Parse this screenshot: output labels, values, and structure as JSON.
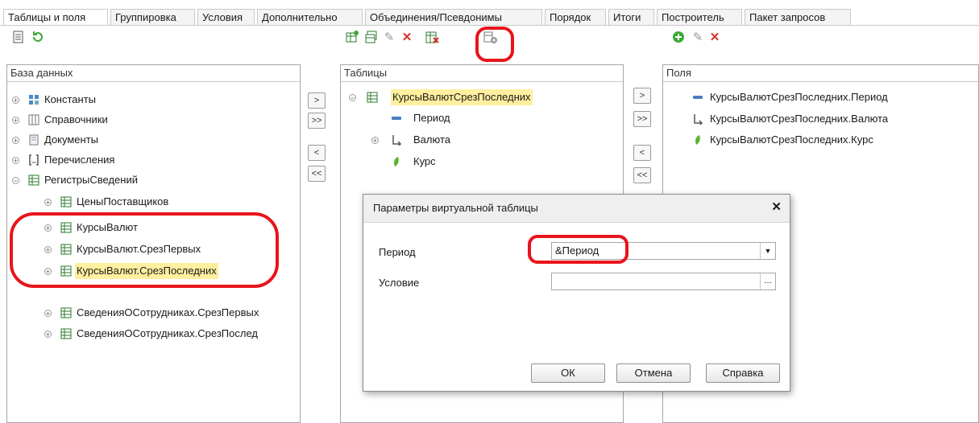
{
  "tabs": [
    "Таблицы и поля",
    "Группировка",
    "Условия",
    "Дополнительно",
    "Объединения/Псевдонимы",
    "Порядок",
    "Итоги",
    "Построитель",
    "Пакет запросов"
  ],
  "left_panel": {
    "header": "База данных",
    "items": [
      {
        "label": "Константы",
        "icon": "constants-icon"
      },
      {
        "label": "Справочники",
        "icon": "catalogs-icon"
      },
      {
        "label": "Документы",
        "icon": "documents-icon"
      },
      {
        "label": "Перечисления",
        "icon": "enums-icon"
      },
      {
        "label": "РегистрыСведений",
        "icon": "register-icon"
      },
      {
        "label": "ЦеныПоставщиков",
        "icon": "table-icon"
      },
      {
        "label": "КурсыВалют",
        "icon": "table-icon"
      },
      {
        "label": "КурсыВалют.СрезПервых",
        "icon": "table-icon"
      },
      {
        "label": "КурсыВалют.СрезПоследних",
        "icon": "table-icon"
      },
      {
        "label": "СведенияОСотрудниках",
        "icon": "table-icon"
      },
      {
        "label": "СведенияОСотрудниках.СрезПервых",
        "icon": "table-icon"
      },
      {
        "label": "СведенияОСотрудниках.СрезПослед",
        "icon": "table-icon"
      }
    ]
  },
  "move_buttons_left": [
    ">",
    ">>",
    "<",
    "<<"
  ],
  "move_buttons_right": [
    ">",
    ">>",
    "<",
    "<<"
  ],
  "middle_panel": {
    "header": "Таблицы",
    "items": [
      {
        "label": "КурсыВалютСрезПоследних",
        "icon": "table-icon"
      },
      {
        "label": "Период",
        "icon": "dimension-icon"
      },
      {
        "label": "Валюта",
        "icon": "reference-icon"
      },
      {
        "label": "Курс",
        "icon": "resource-icon"
      }
    ]
  },
  "right_panel": {
    "header": "Поля",
    "items": [
      {
        "label": "КурсыВалютСрезПоследних.Период",
        "icon": "dimension-icon"
      },
      {
        "label": "КурсыВалютСрезПоследних.Валюта",
        "icon": "reference-icon"
      },
      {
        "label": "КурсыВалютСрезПоследних.Курс",
        "icon": "resource-icon"
      }
    ]
  },
  "dialog": {
    "title": "Параметры виртуальной таблицы",
    "close": "✕",
    "period_label": "Период",
    "period_value": "&Период",
    "condition_label": "Условие",
    "condition_value": "",
    "ellipsis": "...",
    "ok": "ОК",
    "cancel": "Отмена",
    "help": "Справка"
  },
  "colors": {
    "highlight": "#ffef9f",
    "annotation": "#e8141b",
    "add": "#3aa935",
    "delete": "#d9312b"
  }
}
